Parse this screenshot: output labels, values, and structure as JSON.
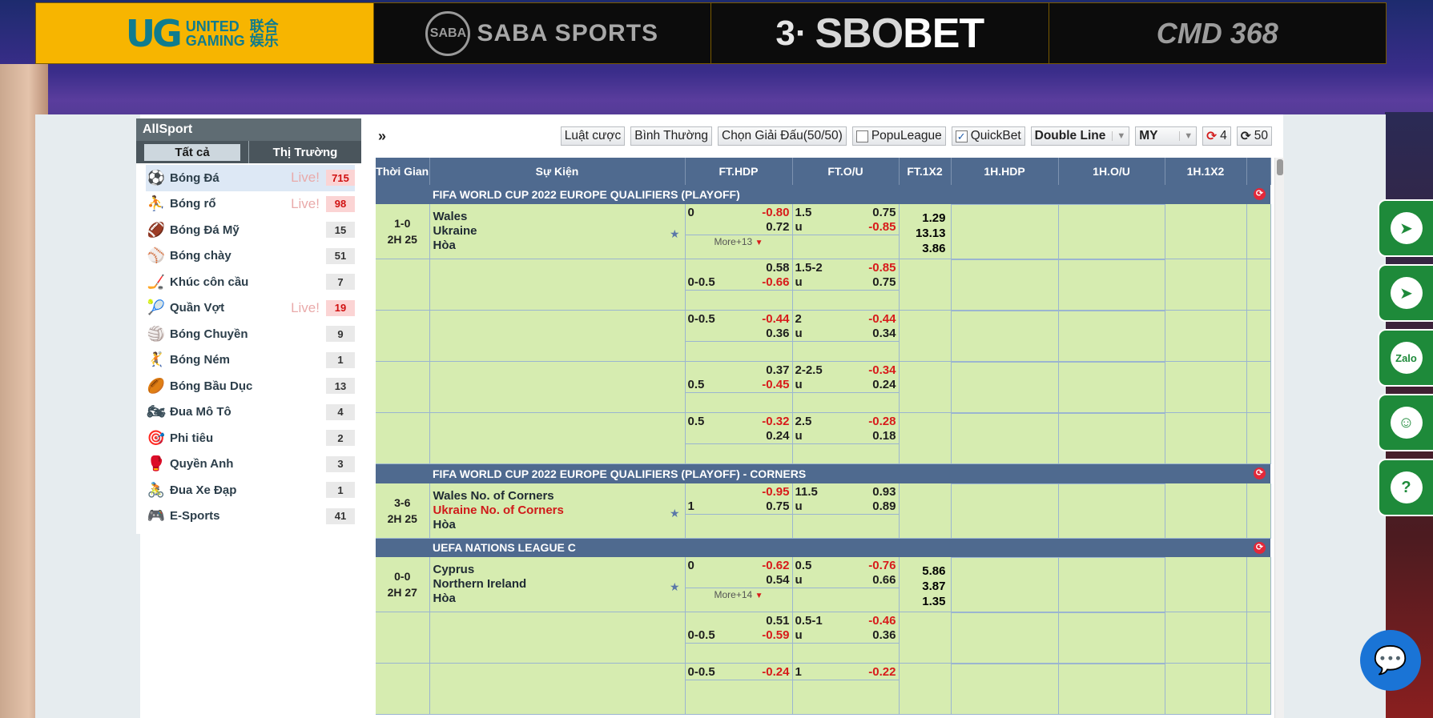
{
  "brands": {
    "ug": {
      "mark": "UG",
      "line1": "UNITED",
      "line2": "GAMING",
      "cjk": "联合 娱乐"
    },
    "saba": {
      "mark": "SABA",
      "text": "SABA SPORTS"
    },
    "sbo": {
      "mark": "3·",
      "text_a": "SBO",
      "text_b": "BET"
    },
    "cmd": {
      "text": "CMD 368"
    }
  },
  "sidebar": {
    "title": "AllSport",
    "tabs": [
      "Tất cả",
      "Thị Trường"
    ],
    "items": [
      {
        "label": "Bóng Đá",
        "live": "Live!",
        "count": "715",
        "hot": true,
        "icon": "soccer-icon"
      },
      {
        "label": "Bóng rổ",
        "live": "Live!",
        "count": "98",
        "hot": true,
        "icon": "basketball-icon"
      },
      {
        "label": "Bóng Đá Mỹ",
        "live": "",
        "count": "15",
        "hot": false,
        "icon": "american-football-icon"
      },
      {
        "label": "Bóng chày",
        "live": "",
        "count": "51",
        "hot": false,
        "icon": "baseball-icon"
      },
      {
        "label": "Khúc côn cầu",
        "live": "",
        "count": "7",
        "hot": false,
        "icon": "hockey-icon"
      },
      {
        "label": "Quần Vợt",
        "live": "Live!",
        "count": "19",
        "hot": true,
        "icon": "tennis-icon"
      },
      {
        "label": "Bóng Chuyền",
        "live": "",
        "count": "9",
        "hot": false,
        "icon": "volleyball-icon"
      },
      {
        "label": "Bóng Ném",
        "live": "",
        "count": "1",
        "hot": false,
        "icon": "handball-icon"
      },
      {
        "label": "Bóng Bầu Dục",
        "live": "",
        "count": "13",
        "hot": false,
        "icon": "rugby-icon"
      },
      {
        "label": "Đua Mô Tô",
        "live": "",
        "count": "4",
        "hot": false,
        "icon": "motorsport-icon"
      },
      {
        "label": "Phi tiêu",
        "live": "",
        "count": "2",
        "hot": false,
        "icon": "darts-icon"
      },
      {
        "label": "Quyền Anh",
        "live": "",
        "count": "3",
        "hot": false,
        "icon": "boxing-icon"
      },
      {
        "label": "Đua Xe Đạp",
        "live": "",
        "count": "1",
        "hot": false,
        "icon": "cycling-icon"
      },
      {
        "label": "E-Sports",
        "live": "",
        "count": "41",
        "hot": false,
        "icon": "gamepad-icon"
      }
    ]
  },
  "toolbar": {
    "expand": "»",
    "rules": "Luật cược",
    "normal": "Bình Thường",
    "choose_league": "Chọn Giải Đấu(50/50)",
    "popular": "PopuLeague",
    "quickbet": "QuickBet",
    "line_mode": "Double Line",
    "odds_type": "MY",
    "refresh_a": "4",
    "refresh_b": "50"
  },
  "table": {
    "headers": [
      "Thời Gian",
      "Sự Kiện",
      "FT.HDP",
      "FT.O/U",
      "FT.1X2",
      "1H.HDP",
      "1H.O/U",
      "1H.1X2"
    ],
    "leagues": [
      {
        "name": "FIFA WORLD CUP 2022 EUROPE QUALIFIERS (PLAYOFF)",
        "matches": [
          {
            "score": "1-0",
            "clock": "2H 25",
            "home": "Wales",
            "away": "Ukraine",
            "draw": "Hòa",
            "away_red": false,
            "more": "More+13",
            "x12": [
              "1.29",
              "13.13",
              "3.86"
            ],
            "rows": [
              {
                "hdp": [
                  "0",
                  "-0.80",
                  "",
                  "0.72"
                ],
                "ou": [
                  "1.5",
                  "0.75",
                  "u",
                  "-0.85"
                ]
              },
              {
                "hdp": [
                  "",
                  "0.58",
                  "0-0.5",
                  "-0.66"
                ],
                "ou": [
                  "1.5-2",
                  "-0.85",
                  "u",
                  "0.75"
                ]
              },
              {
                "hdp": [
                  "0-0.5",
                  "-0.44",
                  "",
                  "0.36"
                ],
                "ou": [
                  "2",
                  "-0.44",
                  "u",
                  "0.34"
                ]
              },
              {
                "hdp": [
                  "",
                  "0.37",
                  "0.5",
                  "-0.45"
                ],
                "ou": [
                  "2-2.5",
                  "-0.34",
                  "u",
                  "0.24"
                ]
              },
              {
                "hdp": [
                  "0.5",
                  "-0.32",
                  "",
                  "0.24"
                ],
                "ou": [
                  "2.5",
                  "-0.28",
                  "u",
                  "0.18"
                ]
              }
            ]
          }
        ]
      },
      {
        "name": "FIFA WORLD CUP 2022 EUROPE QUALIFIERS (PLAYOFF) - CORNERS",
        "matches": [
          {
            "score": "3-6",
            "clock": "2H 25",
            "home": "Wales No. of Corners",
            "away": "Ukraine No. of Corners",
            "draw": "Hòa",
            "away_red": true,
            "more": "",
            "x12": [
              "",
              "",
              ""
            ],
            "rows": [
              {
                "hdp": [
                  "",
                  "-0.95",
                  "1",
                  "0.75"
                ],
                "ou": [
                  "11.5",
                  "0.93",
                  "u",
                  "0.89"
                ]
              }
            ]
          }
        ]
      },
      {
        "name": "UEFA NATIONS LEAGUE C",
        "matches": [
          {
            "score": "0-0",
            "clock": "2H 27",
            "home": "Cyprus",
            "away": "Northern Ireland",
            "draw": "Hòa",
            "away_red": false,
            "more": "More+14",
            "x12": [
              "5.86",
              "3.87",
              "1.35"
            ],
            "rows": [
              {
                "hdp": [
                  "0",
                  "-0.62",
                  "",
                  "0.54"
                ],
                "ou": [
                  "0.5",
                  "-0.76",
                  "u",
                  "0.66"
                ]
              },
              {
                "hdp": [
                  "",
                  "0.51",
                  "0-0.5",
                  "-0.59"
                ],
                "ou": [
                  "0.5-1",
                  "-0.46",
                  "u",
                  "0.36"
                ]
              },
              {
                "hdp": [
                  "0-0.5",
                  "-0.24",
                  "",
                  ""
                ],
                "ou": [
                  "1",
                  "-0.22",
                  "",
                  ""
                ]
              }
            ]
          }
        ]
      }
    ]
  },
  "floating": [
    {
      "icon": "telegram-icon",
      "glyph": "➤"
    },
    {
      "icon": "telegram-icon",
      "glyph": "➤"
    },
    {
      "icon": "zalo-icon",
      "glyph": "Zalo"
    },
    {
      "icon": "support-agent-icon",
      "glyph": "☺"
    },
    {
      "icon": "help-icon",
      "glyph": "?"
    }
  ],
  "colors": {
    "header": "#4f6a8f",
    "row": "#d6ecb0",
    "negative": "#d81a1a",
    "brand_ug": "#f7b500"
  }
}
